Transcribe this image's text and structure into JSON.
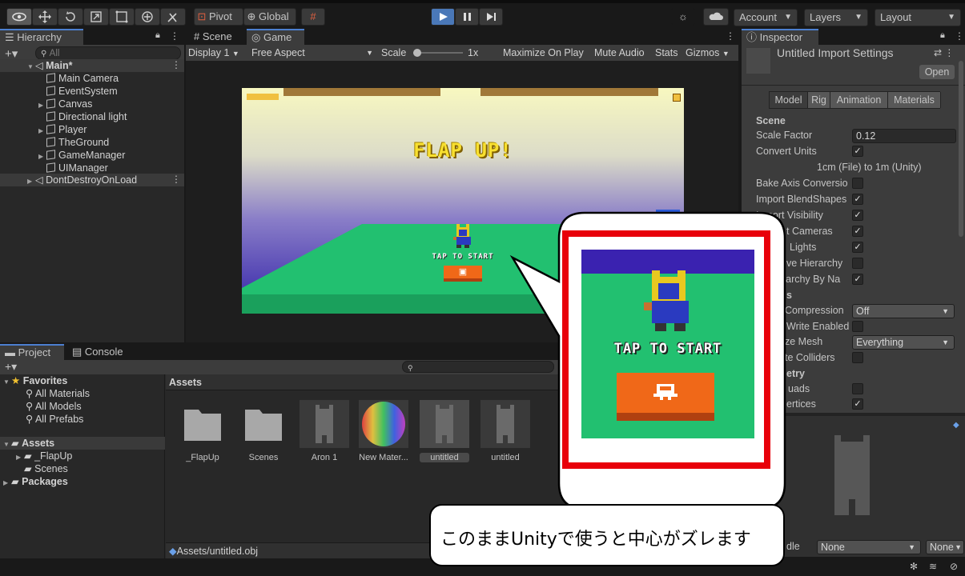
{
  "toolbar": {
    "pivot": "Pivot",
    "global": "Global",
    "account": "Account",
    "layers": "Layers",
    "layout": "Layout"
  },
  "hierarchy": {
    "tab": "Hierarchy",
    "search_placeholder": "All",
    "scene": "Main*",
    "items": [
      "Main Camera",
      "EventSystem",
      "Canvas",
      "Directional light",
      "Player",
      "TheGround",
      "GameManager",
      "UIManager"
    ],
    "dont_destroy": "DontDestroyOnLoad"
  },
  "game": {
    "tab_scene": "Scene",
    "tab_game": "Game",
    "display": "Display 1",
    "aspect": "Free Aspect",
    "scale_label": "Scale",
    "scale_value": "1x",
    "maximize": "Maximize On Play",
    "mute": "Mute Audio",
    "stats": "Stats",
    "gizmos": "Gizmos",
    "title": "FLAP UP!",
    "tap": "TAP TO START"
  },
  "inspector": {
    "tab": "Inspector",
    "title": "Untitled Import Settings",
    "open": "Open",
    "tabs": [
      "Model",
      "Rig",
      "Animation",
      "Materials"
    ],
    "section_scene": "Scene",
    "scale_factor_label": "Scale Factor",
    "scale_factor": "0.12",
    "convert_units": "Convert Units",
    "units_note": "1cm (File) to 1m (Unity)",
    "bake_axis": "Bake Axis Conversio",
    "import_blendshapes": "Import BlendShapes",
    "import_visibility": "Import Visibility",
    "import_cameras": "t Cameras",
    "import_lights": "Lights",
    "preserve_hierarchy": "ve Hierarchy",
    "sort_hierarchy": "erarchy By Na",
    "section_meshes": "s",
    "mesh_compression": "Compression",
    "mesh_compression_value": "Off",
    "read_write": "Write Enabled",
    "optimize_mesh": "ze Mesh",
    "optimize_mesh_value": "Everything",
    "generate_colliders": "te Colliders",
    "section_geometry": "etry",
    "keep_quads": "uads",
    "weld_vertices": "ertices",
    "bundle_label": "dle",
    "bundle_value": "None",
    "bundle_variant": "None"
  },
  "project": {
    "tab_project": "Project",
    "tab_console": "Console",
    "favorites": "Favorites",
    "fav_items": [
      "All Materials",
      "All Models",
      "All Prefabs"
    ],
    "assets": "Assets",
    "asset_folders": [
      "_FlapUp",
      "Scenes"
    ],
    "packages": "Packages",
    "breadcrumb": "Assets",
    "assets_grid": [
      "_FlapUp",
      "Scenes",
      "Aron 1",
      "New Mater...",
      "untitled",
      "untitled"
    ],
    "status_path": "Assets/untitled.obj"
  },
  "callout": {
    "text": "このままUnityで使うと中心がズレます"
  }
}
